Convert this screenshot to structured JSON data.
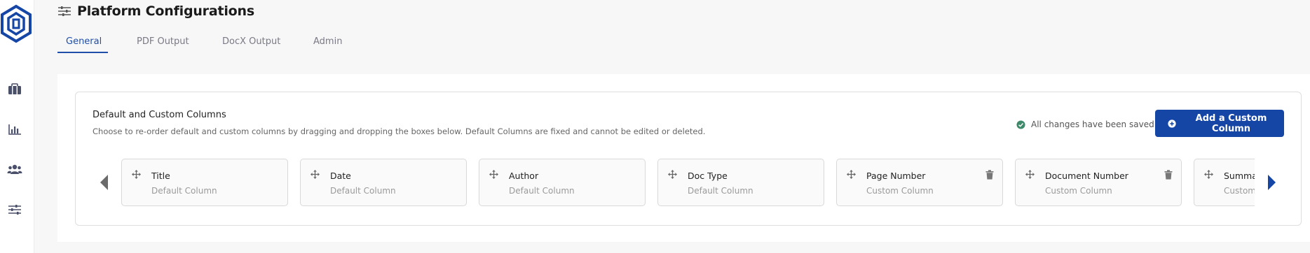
{
  "sidebar": {
    "logo_icon": "brand-hexagon-logo",
    "items": [
      {
        "icon": "briefcase-icon"
      },
      {
        "icon": "bar-chart-icon"
      },
      {
        "icon": "users-icon"
      },
      {
        "icon": "sliders-icon"
      }
    ]
  },
  "header": {
    "icon": "sliders-icon",
    "title": "Platform Configurations"
  },
  "tabs": [
    {
      "label": "General",
      "active": true
    },
    {
      "label": "PDF Output",
      "active": false
    },
    {
      "label": "DocX Output",
      "active": false
    },
    {
      "label": "Admin",
      "active": false
    }
  ],
  "columns_section": {
    "title": "Default and Custom Columns",
    "description": "Choose to re-order default and custom columns by dragging and dropping the boxes below. Default Columns are fixed and cannot be edited or deleted.",
    "saved_status": "All changes have been saved.",
    "add_button_label": "Add a Custom Column",
    "columns": [
      {
        "name": "Title",
        "type": "Default Column",
        "deletable": false
      },
      {
        "name": "Date",
        "type": "Default Column",
        "deletable": false
      },
      {
        "name": "Author",
        "type": "Default Column",
        "deletable": false
      },
      {
        "name": "Doc Type",
        "type": "Default Column",
        "deletable": false
      },
      {
        "name": "Page Number",
        "type": "Custom Column",
        "deletable": true
      },
      {
        "name": "Document Number",
        "type": "Custom Column",
        "deletable": true
      },
      {
        "name": "Summary",
        "type": "Custom Column",
        "deletable": true
      }
    ]
  },
  "colors": {
    "primary": "#1546a6",
    "tab_active": "#1f4fa8",
    "saved_check": "#3c8a6b",
    "sidebar_icon": "#4a4f6a"
  }
}
